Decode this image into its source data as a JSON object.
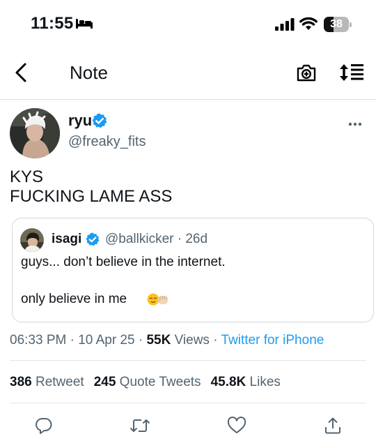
{
  "status_bar": {
    "time": "11:55",
    "battery_level": "38",
    "icons": [
      "bed-icon",
      "signal-icon",
      "wifi-icon",
      "battery-icon"
    ]
  },
  "nav": {
    "title": "Note",
    "icons": [
      "back-chevron-icon",
      "camera-add-icon",
      "sort-icon"
    ]
  },
  "tweet": {
    "display_name": "ryu",
    "handle": "@freaky_fits",
    "line1": "KYS",
    "line2": "FUCKING LAME ASS",
    "more_icon": "more-icon"
  },
  "quote": {
    "display_name": "isagi",
    "handle_time": "@ballkicker · 26d",
    "line1": "guys... don’t believe in the internet.",
    "line2": "only believe in me",
    "emojis": [
      "relieved-face-emoji",
      "raised-fist-emoji"
    ]
  },
  "meta": {
    "time": "06:33 PM",
    "date": "10 Apr 25",
    "views_count": "55K",
    "views_label": "Views",
    "source": "Twitter for iPhone",
    "sep": " · "
  },
  "stats": {
    "retweets_count": "386",
    "retweets_label": "Retweet",
    "quotes_count": "245",
    "quotes_label": "Quote Tweets",
    "likes_count": "45.8K",
    "likes_label": "Likes"
  },
  "actions": [
    "reply-icon",
    "retweet-icon",
    "like-icon",
    "share-icon"
  ],
  "colors": {
    "accent": "#1d9bf0",
    "secondary_text": "#536471",
    "primary_text": "#0f1419",
    "divider": "#e1e6ea"
  }
}
